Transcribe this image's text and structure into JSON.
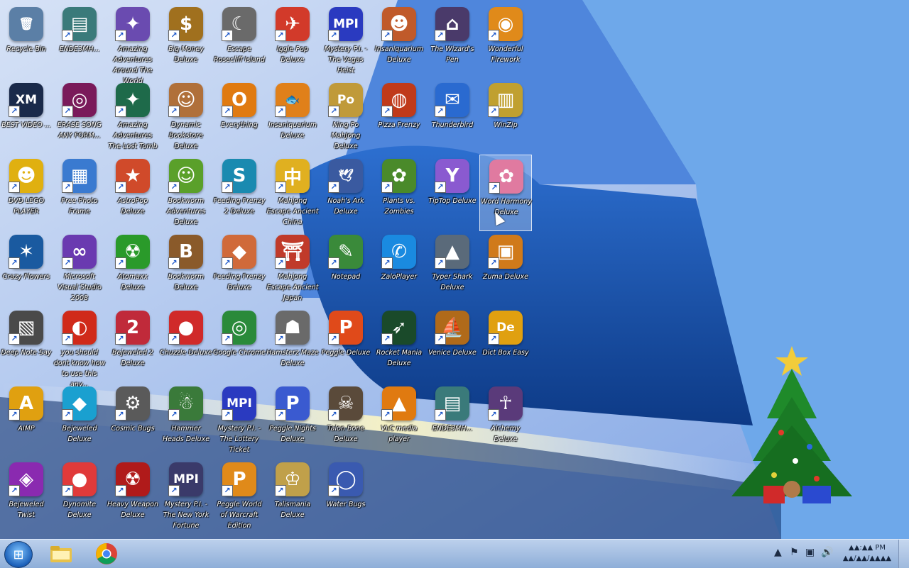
{
  "desktop": {
    "icons": [
      {
        "label": "Recycle Bin",
        "glyph": "🗑",
        "color": "#5b7fa6",
        "shortcut": false
      },
      {
        "label": "ENDE3MH...",
        "glyph": "▤",
        "color": "#3a7a7a",
        "shortcut": true
      },
      {
        "label": "Amazing Adventures Around The World",
        "glyph": "✦",
        "color": "#6a4bb0",
        "shortcut": true
      },
      {
        "label": "Big Money Deluxe",
        "glyph": "$",
        "color": "#a0701e",
        "shortcut": true
      },
      {
        "label": "Escape Rosecliff Island",
        "glyph": "☾",
        "color": "#6a6a6a",
        "shortcut": true
      },
      {
        "label": "Iggle Pop Deluxe",
        "glyph": "✈",
        "color": "#d23a2a",
        "shortcut": true
      },
      {
        "label": "Mystery P.I. - The Vegas Heist",
        "glyph": "MPI",
        "color": "#2a3ac0",
        "shortcut": true
      },
      {
        "label": "Insaniquarium Deluxe",
        "glyph": "☻",
        "color": "#c05a2a",
        "shortcut": true
      },
      {
        "label": "The Wizard's Pen",
        "glyph": "⌂",
        "color": "#4a3a6a",
        "shortcut": true
      },
      {
        "label": "Wonderful Firework",
        "glyph": "◉",
        "color": "#e08a1a",
        "shortcut": true
      },
      {
        "label": "BEST VIDEO ...",
        "glyph": "XM",
        "color": "#1a2a4a",
        "shortcut": true
      },
      {
        "label": "ERASE SONG ANY FORM...",
        "glyph": "◎",
        "color": "#7a1a5a",
        "shortcut": true
      },
      {
        "label": "Amazing Adventures The Lost Tomb",
        "glyph": "✦",
        "color": "#1e6a4a",
        "shortcut": true
      },
      {
        "label": "Dynamic Bookstore Deluxe",
        "glyph": "☺",
        "color": "#b0703a",
        "shortcut": true
      },
      {
        "label": "Everything",
        "glyph": "O",
        "color": "#e07a10",
        "shortcut": true
      },
      {
        "label": "Insaniquarium Deluxe",
        "glyph": "🐟",
        "color": "#e0801a",
        "shortcut": true
      },
      {
        "label": "Ning Po MahJong Deluxe",
        "glyph": "Po",
        "color": "#c09a3a",
        "shortcut": true
      },
      {
        "label": "Pizza Frenzy",
        "glyph": "◍",
        "color": "#c03a1a",
        "shortcut": true
      },
      {
        "label": "Thunderbird",
        "glyph": "✉",
        "color": "#2a6ad0",
        "shortcut": true
      },
      {
        "label": "WinZip",
        "glyph": "▥",
        "color": "#c0a030",
        "shortcut": true
      },
      {
        "label": "DVD LEGO PLAYER",
        "glyph": "☻",
        "color": "#e0b010",
        "shortcut": true
      },
      {
        "label": "Free Photo Frame",
        "glyph": "▦",
        "color": "#3a7ad0",
        "shortcut": true
      },
      {
        "label": "AstroPop Deluxe",
        "glyph": "★",
        "color": "#d04a2a",
        "shortcut": true
      },
      {
        "label": "Bookworm Adventures Deluxe",
        "glyph": "☺",
        "color": "#5aa02a",
        "shortcut": true
      },
      {
        "label": "Feeding Frenzy 2 Deluxe",
        "glyph": "S",
        "color": "#1a8ab0",
        "shortcut": true
      },
      {
        "label": "Mahjong Escape Ancient China",
        "glyph": "中",
        "color": "#e0b020",
        "shortcut": true
      },
      {
        "label": "Noah's Ark Deluxe",
        "glyph": "🕊",
        "color": "#3a5aa0",
        "shortcut": true
      },
      {
        "label": "Plants vs. Zombies",
        "glyph": "✿",
        "color": "#4a8a2a",
        "shortcut": true
      },
      {
        "label": "TipTop Deluxe",
        "glyph": "Y",
        "color": "#8a5ad0",
        "shortcut": true
      },
      {
        "label": "Word Harmony Deluxe",
        "glyph": "✿",
        "color": "#e07aa0",
        "shortcut": true
      },
      {
        "label": "Crazy Flowers",
        "glyph": "✶",
        "color": "#1a5aa0",
        "shortcut": true
      },
      {
        "label": "Microsoft Visual Studio 2008",
        "glyph": "∞",
        "color": "#6a3ab0",
        "shortcut": true
      },
      {
        "label": "Atomaxx Deluxe",
        "glyph": "☢",
        "color": "#2a9a2a",
        "shortcut": true
      },
      {
        "label": "Bookworm Deluxe",
        "glyph": "B",
        "color": "#8a5a2a",
        "shortcut": true
      },
      {
        "label": "Feeding Frenzy Deluxe",
        "glyph": "◆",
        "color": "#d06a3a",
        "shortcut": true
      },
      {
        "label": "Mahjong Escape Ancient Japan",
        "glyph": "⛩",
        "color": "#c03a2a",
        "shortcut": true
      },
      {
        "label": "Notepad",
        "glyph": "✎",
        "color": "#3a8a3a",
        "shortcut": true
      },
      {
        "label": "ZaloPlayer",
        "glyph": "✆",
        "color": "#1a8ae0",
        "shortcut": true
      },
      {
        "label": "Typer Shark Deluxe",
        "glyph": "▲",
        "color": "#5a6a7a",
        "shortcut": true
      },
      {
        "label": "Zuma Deluxe",
        "glyph": "▣",
        "color": "#d07a1a",
        "shortcut": true
      },
      {
        "label": "Deep Note Say",
        "glyph": "▧",
        "color": "#4a4a4a",
        "shortcut": true
      },
      {
        "label": "you should dont know how to use this any...",
        "glyph": "◐",
        "color": "#d02a1a",
        "shortcut": true
      },
      {
        "label": "Bejeweled 2 Deluxe",
        "glyph": "2",
        "color": "#c02a3a",
        "shortcut": true
      },
      {
        "label": "Chuzzle Deluxe",
        "glyph": "●",
        "color": "#d02a2a",
        "shortcut": true
      },
      {
        "label": "Google Chrome",
        "glyph": "◎",
        "color": "#2a8a3a",
        "shortcut": true
      },
      {
        "label": "Hamsterz Maze Deluxe",
        "glyph": "☗",
        "color": "#6a6a6a",
        "shortcut": true
      },
      {
        "label": "Peggle Deluxe",
        "glyph": "P",
        "color": "#e04a1a",
        "shortcut": true
      },
      {
        "label": "Rocket Mania Deluxe",
        "glyph": "➶",
        "color": "#1a4a2a",
        "shortcut": true
      },
      {
        "label": "Venice Deluxe",
        "glyph": "⛵",
        "color": "#b06a1a",
        "shortcut": true
      },
      {
        "label": "Dict Box Easy",
        "glyph": "De",
        "color": "#e0a010",
        "shortcut": true
      },
      {
        "label": "AIMP",
        "glyph": "A",
        "color": "#e0a010",
        "shortcut": true
      },
      {
        "label": "Bejeweled Deluxe",
        "glyph": "◆",
        "color": "#1aa0d0",
        "shortcut": true
      },
      {
        "label": "Cosmic Bugs",
        "glyph": "⚙",
        "color": "#5a5a5a",
        "shortcut": true
      },
      {
        "label": "Hammer Heads Deluxe",
        "glyph": "☃",
        "color": "#3a7a3a",
        "shortcut": true
      },
      {
        "label": "Mystery P.I. - The Lottery Ticket",
        "glyph": "MPI",
        "color": "#2a3ac0",
        "shortcut": true
      },
      {
        "label": "Peggle Nights Deluxe",
        "glyph": "P",
        "color": "#3a5ad0",
        "shortcut": true
      },
      {
        "label": "Talon Bone Deluxe",
        "glyph": "☠",
        "color": "#5a4a3a",
        "shortcut": true
      },
      {
        "label": "VLC media player",
        "glyph": "▲",
        "color": "#e07a10",
        "shortcut": true
      },
      {
        "label": "ENDE3MH...",
        "glyph": "▤",
        "color": "#3a7a7a",
        "shortcut": true
      },
      {
        "label": "Alchemy Deluxe",
        "glyph": "☥",
        "color": "#5a3a7a",
        "shortcut": true
      },
      {
        "label": "Bejeweled Twist",
        "glyph": "◈",
        "color": "#8a2ab0",
        "shortcut": true
      },
      {
        "label": "Dynomite Deluxe",
        "glyph": "●",
        "color": "#e03a3a",
        "shortcut": true
      },
      {
        "label": "Heavy Weapon Deluxe",
        "glyph": "☢",
        "color": "#b01a1a",
        "shortcut": true
      },
      {
        "label": "Mystery P.I. - The New York Fortune",
        "glyph": "MPI",
        "color": "#3a3a6a",
        "shortcut": true
      },
      {
        "label": "Peggle World of Warcraft Edition",
        "glyph": "P",
        "color": "#e08a1a",
        "shortcut": true
      },
      {
        "label": "Talismania Deluxe",
        "glyph": "♔",
        "color": "#c0a04a",
        "shortcut": true
      },
      {
        "label": "Water Bugs",
        "glyph": "◯",
        "color": "#3a5ab0",
        "shortcut": true
      }
    ],
    "selected_label": "Word Harmony Deluxe"
  },
  "taskbar": {
    "start_label": "Start",
    "pinned": [
      {
        "name": "file-explorer",
        "glyph": "📁"
      },
      {
        "name": "google-chrome",
        "glyph": "◎"
      }
    ],
    "tray_icons": [
      {
        "name": "show-hidden-icons-icon",
        "glyph": "▲"
      },
      {
        "name": "action-center-icon",
        "glyph": "⚑"
      },
      {
        "name": "network-icon",
        "glyph": "▣"
      },
      {
        "name": "volume-icon",
        "glyph": "🔊"
      }
    ],
    "clock_time": "▲▲:▲▲ PM",
    "clock_date": "▲▲/▲▲/▲▲▲▲"
  }
}
